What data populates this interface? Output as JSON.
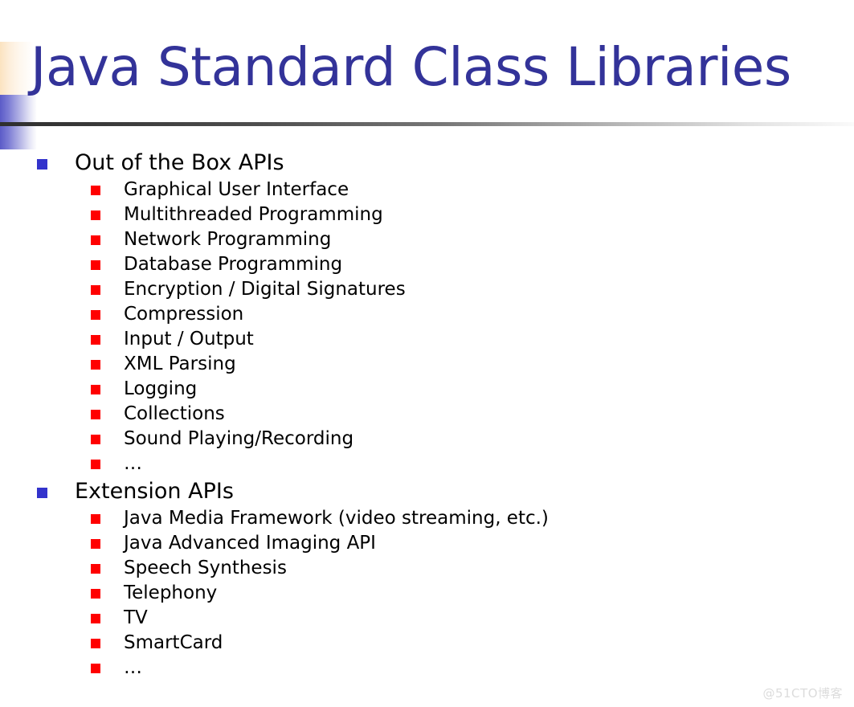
{
  "slide": {
    "title": "Java Standard Class Libraries",
    "background_color": "#ffffff",
    "title_color": "#333399",
    "bullet_level1_color": "#3333cc",
    "bullet_level2_color": "#ff0000",
    "text_color": "#000000",
    "accent_peach_color": "#fbe3c0",
    "accent_blue_color": "#5b5bc8",
    "rule_color": "#2f2f2f"
  },
  "content": {
    "groups": [
      {
        "heading": "Out of the Box APIs",
        "items": [
          "Graphical User Interface",
          "Multithreaded Programming",
          "Network Programming",
          "Database Programming",
          "Encryption / Digital Signatures",
          "Compression",
          "Input / Output",
          "XML Parsing",
          "Logging",
          "Collections",
          "Sound Playing/Recording",
          "…"
        ]
      },
      {
        "heading": "Extension APIs",
        "items": [
          "Java Media Framework (video streaming, etc.)",
          "Java Advanced Imaging API",
          "Speech Synthesis",
          "Telephony",
          "TV",
          "SmartCard",
          "…"
        ]
      }
    ]
  },
  "watermark": {
    "text": "@51CTO博客"
  }
}
